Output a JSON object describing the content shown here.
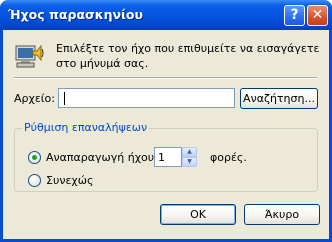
{
  "window": {
    "title": "Ήχος παρασκηνίου",
    "help_button": "?",
    "close_button": "✕"
  },
  "message": {
    "line1": "Επιλέξτε τον ήχο που επιθυμείτε να εισαγάγετε",
    "line2": "στο μήνυμά σας."
  },
  "file": {
    "label": "Αρχείο:",
    "value": "",
    "browse_label": "Αναζήτηση..."
  },
  "repeat": {
    "group_label": "Ρύθμιση επαναλήψεων",
    "option_play_label": "Αναπαραγωγή ήχου",
    "option_play_selected": true,
    "count": "1",
    "times_label": "φορές.",
    "option_continuous_label": "Συνεχώς",
    "option_continuous_selected": false
  },
  "buttons": {
    "ok_label": "OK",
    "cancel_label": "Άκυρο"
  }
}
